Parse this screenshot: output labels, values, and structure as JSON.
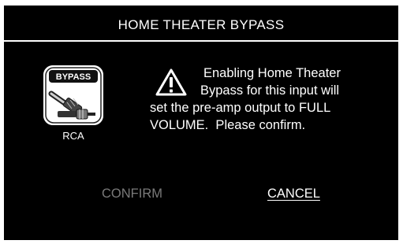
{
  "dialog": {
    "title": "HOME THEATER BYPASS",
    "input": {
      "icon_badge_text": "BYPASS",
      "label": "RCA",
      "icon": "rca-cable-icon"
    },
    "warning_icon": "warning-triangle-icon",
    "message_lines": [
      "Enabling Home Theater",
      "Bypass for this input will",
      "set the pre-amp output to FULL",
      "VOLUME.  Please confirm."
    ],
    "buttons": {
      "confirm_label": "CONFIRM",
      "confirm_state": "disabled",
      "cancel_label": "CANCEL",
      "cancel_state": "selected"
    }
  },
  "colors": {
    "background": "#000000",
    "text": "#ffffff",
    "disabled_text": "#7a7a7a"
  }
}
